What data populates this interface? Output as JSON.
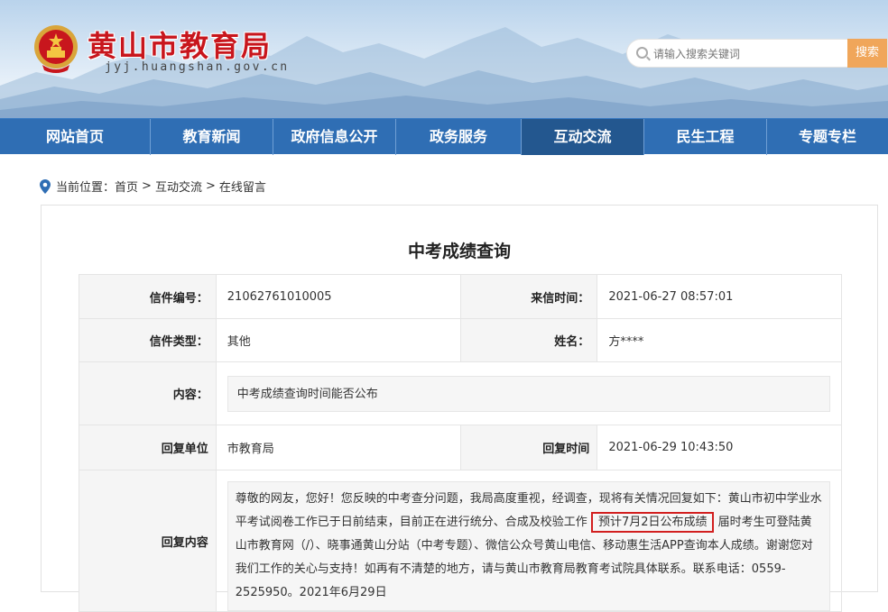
{
  "header": {
    "title": "黄山市教育局",
    "domain": "jyj.huangshan.gov.cn",
    "search_placeholder": "请输入搜索关键词",
    "search_button": "搜索"
  },
  "nav": {
    "items": [
      {
        "label": "网站首页"
      },
      {
        "label": "教育新闻"
      },
      {
        "label": "政府信息公开"
      },
      {
        "label": "政务服务"
      },
      {
        "label": "互动交流",
        "active": true
      },
      {
        "label": "民生工程"
      },
      {
        "label": "专题专栏"
      }
    ]
  },
  "breadcrumb": {
    "prefix": "当前位置：",
    "items": [
      "首页",
      "互动交流",
      "在线留言"
    ],
    "separator": ">"
  },
  "page": {
    "title": "中考成绩查询"
  },
  "letter": {
    "number_label": "信件编号：",
    "number": "21062761010005",
    "time_label": "来信时间：",
    "time": "2021-06-27 08:57:01",
    "type_label": "信件类型：",
    "type": "其他",
    "name_label": "姓名：",
    "name": "方****",
    "content_label": "内容：",
    "content": "中考成绩查询时间能否公布",
    "reply_unit_label": "回复单位",
    "reply_unit": "市教育局",
    "reply_time_label": "回复时间",
    "reply_time": "2021-06-29 10:43:50",
    "reply_content_label": "回复内容",
    "reply_part1": "尊敬的网友，您好！您反映的中考查分问题，我局高度重视，经调查，现将有关情况回复如下：黄山市初中学业水平考试阅卷工作已于日前结束，目前正在进行统分、合成及校验工作",
    "reply_highlight": "预计7月2日公布成绩",
    "reply_part2": "届时考生可登陆黄山市教育网（/）、晓事通黄山分站（中考专题）、微信公众号黄山电信、移动惠生活APP查询本人成绩。谢谢您对我们工作的关心与支持！如再有不清楚的地方，请与黄山市教育局教育考试院具体联系。联系电话：0559-2525950。2021年6月29日"
  },
  "colors": {
    "nav_bg": "#2f6eb4",
    "nav_active": "#23578f",
    "title_red": "#c8161d",
    "search_button": "#f0a65a",
    "highlight_border": "#d21f1f"
  }
}
